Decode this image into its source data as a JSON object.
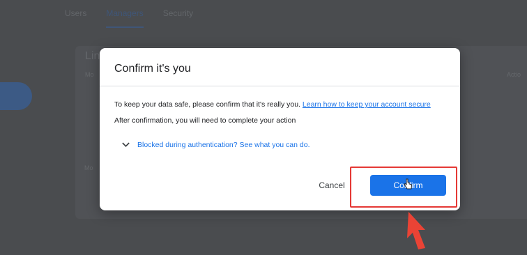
{
  "background": {
    "tabs": [
      "Users",
      "Managers",
      "Security"
    ],
    "active_tab": "Managers",
    "card_title": "Lin",
    "col_left": "Mo",
    "col_right": "Actio",
    "row_label": "Mo"
  },
  "dialog": {
    "title": "Confirm it's you",
    "text_line1": "To keep your data safe, please confirm that it's really you.",
    "link_text": "Learn how to keep your account secure",
    "text_line2": "After confirmation, you will need to complete your action",
    "expander_label": "Blocked during authentication? See what you can do.",
    "cancel_label": "Cancel",
    "confirm_label": "Confirm"
  },
  "colors": {
    "accent": "#1a73e8",
    "highlight": "#e53935",
    "overlay": "#4a4c4f"
  },
  "icons": {
    "expander": "chevron-down-icon",
    "pointer": "hand-cursor-icon",
    "annotation_arrow": "red-arrow-icon"
  }
}
